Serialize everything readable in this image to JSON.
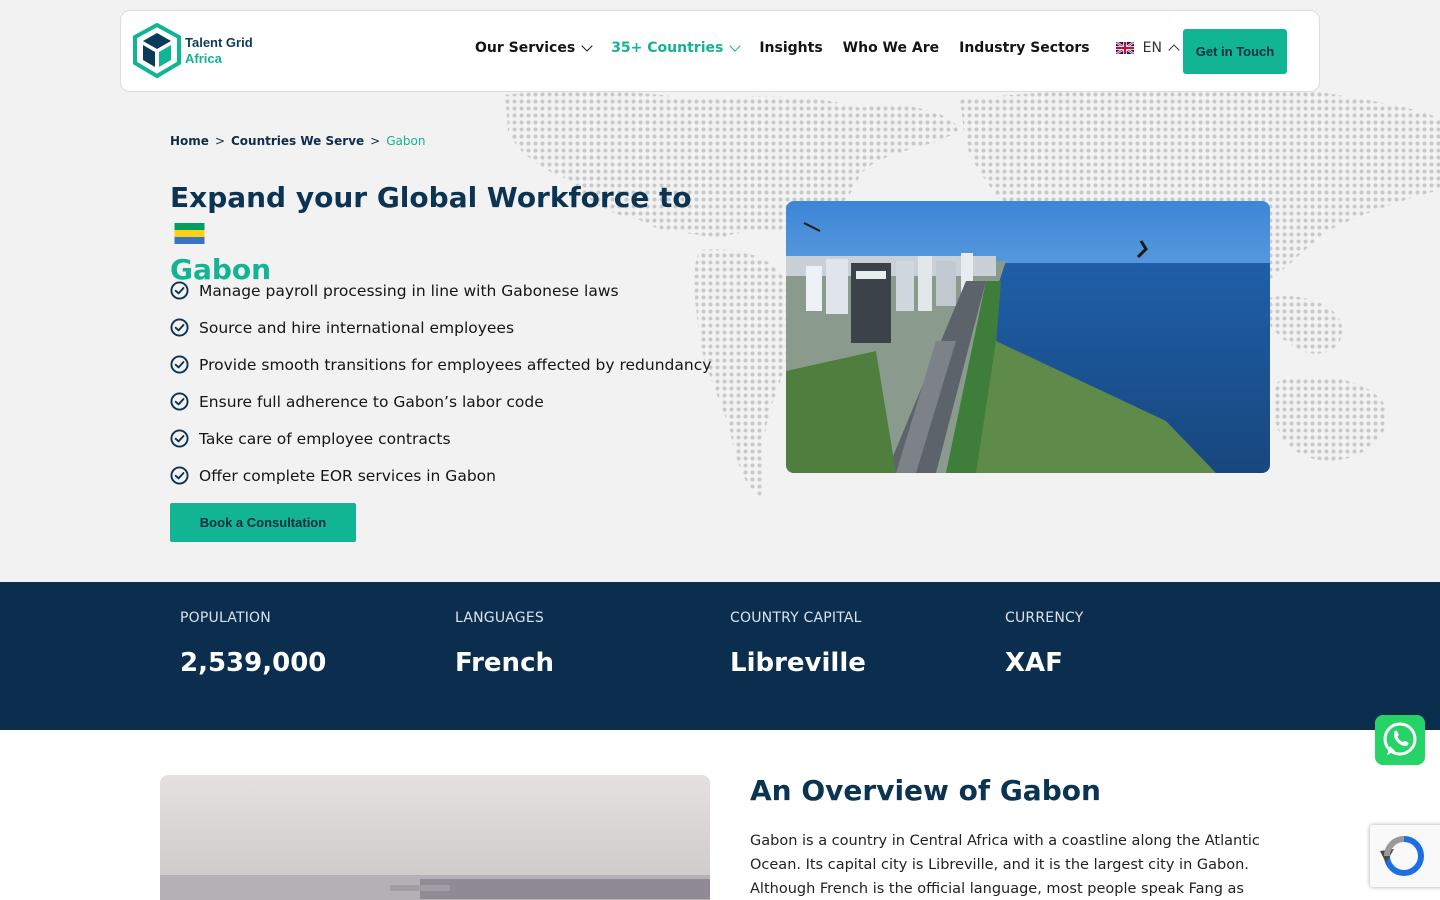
{
  "header": {
    "logo_line1": "Talent Grid",
    "logo_line2": "Africa",
    "nav": {
      "services": "Our Services",
      "countries": "35+ Countries",
      "insights": "Insights",
      "who": "Who We Are",
      "sectors": "Industry Sectors",
      "lang": "EN"
    },
    "cta": "Get in Touch"
  },
  "breadcrumb": {
    "home": "Home",
    "sep1": ">",
    "countries": "Countries We Serve",
    "sep2": ">",
    "current": "Gabon"
  },
  "hero": {
    "title_line1": "Expand your Global Workforce to",
    "title_line2": "Gabon",
    "checklist": [
      "Manage payroll processing in line with Gabonese laws",
      "Source and hire international employees",
      "Provide smooth transitions for employees affected by redundancy",
      "Ensure full adherence to Gabon’s labor code",
      "Take care of employee contracts",
      "Offer complete EOR services in Gabon"
    ],
    "button": "Book a Consultation"
  },
  "stats": [
    {
      "label": "POPULATION",
      "value": "2,539,000"
    },
    {
      "label": "LANGUAGES",
      "value": "French"
    },
    {
      "label": "COUNTRY CAPITAL",
      "value": "Libreville"
    },
    {
      "label": "CURRENCY",
      "value": "XAF"
    }
  ],
  "overview": {
    "title": "An Overview of Gabon",
    "text": "Gabon is a country in Central Africa with a coastline along the Atlantic Ocean. Its capital city is Libreville, and it is the largest city in Gabon. Although French is the official language, most people speak Fang as their"
  },
  "colors": {
    "accent": "#11b493",
    "navy": "#0b2e4e",
    "heading": "#0b3352",
    "whatsapp": "#25d366"
  }
}
